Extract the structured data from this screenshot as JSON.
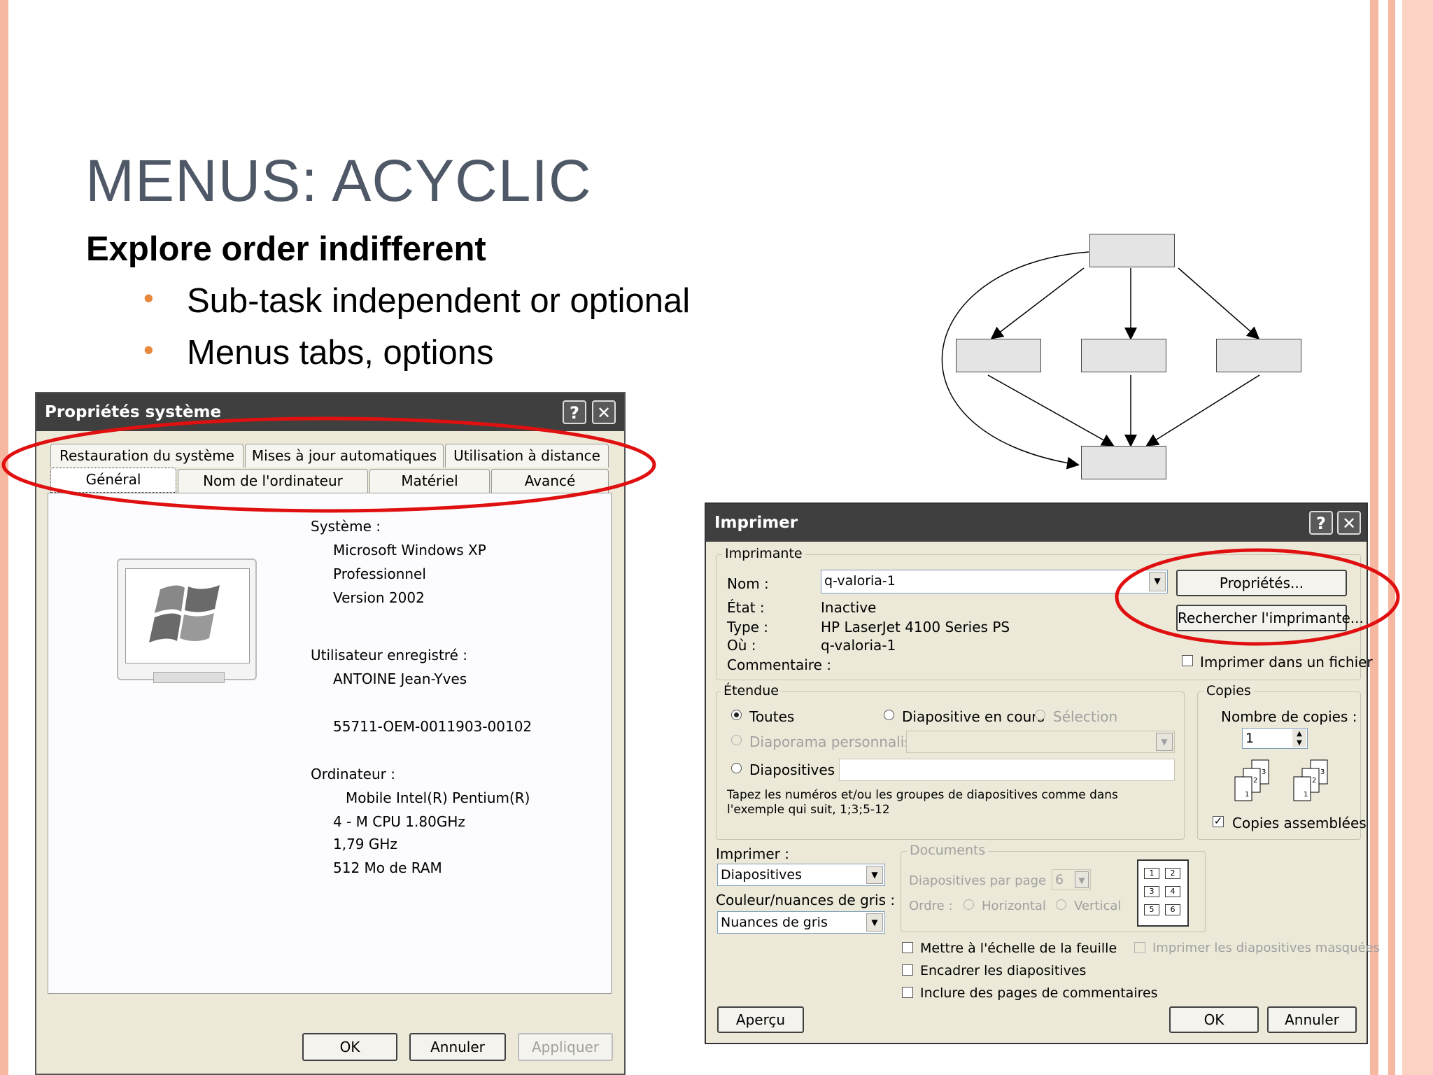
{
  "slide": {
    "title": "MENUS: ACYCLIC",
    "subtitle": "Explore order indifferent",
    "bullets": [
      "Sub-task independent or optional",
      "Menus tabs, options"
    ]
  },
  "colors": {
    "accent_border": "#f7b8a2",
    "bullet": "#e8893e",
    "highlight_ellipse": "#e01010",
    "titlebar": "#3f3f3f"
  },
  "system_dialog": {
    "title": "Propriétés système",
    "help_label": "?",
    "close_label": "✕",
    "tabs_row1": [
      "Restauration du système",
      "Mises à jour automatiques",
      "Utilisation à distance"
    ],
    "tabs_row2": [
      "Général",
      "Nom de l'ordinateur",
      "Matériel",
      "Avancé"
    ],
    "system_label": "Système :",
    "system_lines": [
      "Microsoft Windows XP",
      "Professionnel",
      "Version 2002"
    ],
    "user_label": "Utilisateur enregistré :",
    "user_name": "ANTOINE Jean-Yves",
    "product_id": "55711-OEM-0011903-00102",
    "computer_label": "Ordinateur :",
    "computer_lines": [
      "Mobile Intel(R) Pentium(R)",
      "4 - M CPU 1.80GHz",
      "1,79 GHz",
      "512 Mo de RAM"
    ],
    "ok_label": "OK",
    "cancel_label": "Annuler",
    "apply_label": "Appliquer"
  },
  "print_dialog": {
    "title": "Imprimer",
    "help_label": "?",
    "close_label": "✕",
    "printer_group": "Imprimante",
    "name_label": "Nom :",
    "name_value": "q-valoria-1",
    "state_label": "État :",
    "state_value": "Inactive",
    "type_label": "Type :",
    "type_value": "HP LaserJet 4100 Series PS",
    "where_label": "Où :",
    "where_value": "q-valoria-1",
    "comment_label": "Commentaire :",
    "properties_label": "Propriétés...",
    "find_printer_label": "Rechercher l'imprimante...",
    "print_to_file_label": "Imprimer dans un fichier",
    "range_group": "Étendue",
    "all_label": "Toutes",
    "current_slide_label": "Diapositive en cours",
    "selection_label": "Sélection",
    "custom_show_label": "Diaporama personnalisé :",
    "slides_label": "Diapositives :",
    "range_hint": "Tapez les numéros et/ou les groupes de diapositives comme dans l'exemple qui suit, 1;3;5-12",
    "copies_group": "Copies",
    "copies_count_label": "Nombre de copies :",
    "copies_value": "1",
    "collate_label": "Copies assemblées",
    "print_what_label": "Imprimer :",
    "print_what_value": "Diapositives",
    "color_label": "Couleur/nuances de gris :",
    "color_value": "Nuances de gris",
    "documents_group": "Documents",
    "per_page_label": "Diapositives par page :",
    "per_page_value": "6",
    "order_label": "Ordre :",
    "horizontal_label": "Horizontal",
    "vertical_label": "Vertical",
    "page_preview_numbers": [
      "1",
      "2",
      "3",
      "4",
      "5",
      "6"
    ],
    "scale_label": "Mettre à l'échelle de la feuille",
    "frame_label": "Encadrer les diapositives",
    "comments_pages_label": "Inclure des pages de commentaires",
    "hidden_label": "Imprimer les diapositives masquées",
    "preview_label": "Aperçu",
    "ok_label": "OK",
    "cancel_label": "Annuler"
  }
}
